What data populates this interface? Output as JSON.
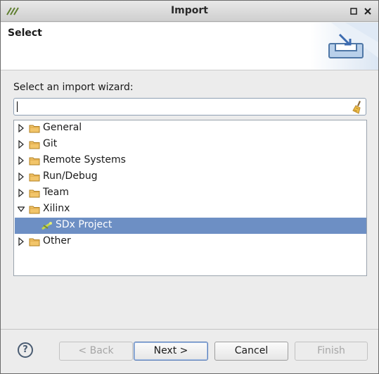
{
  "window": {
    "title": "Import"
  },
  "banner": {
    "heading": "Select"
  },
  "wizard": {
    "prompt": "Select an import wizard:",
    "filter_value": "",
    "tree": [
      {
        "label": "General",
        "expanded": false
      },
      {
        "label": "Git",
        "expanded": false
      },
      {
        "label": "Remote Systems",
        "expanded": false
      },
      {
        "label": "Run/Debug",
        "expanded": false
      },
      {
        "label": "Team",
        "expanded": false
      },
      {
        "label": "Xilinx",
        "expanded": true,
        "children": [
          {
            "label": "SDx Project",
            "selected": true
          }
        ]
      },
      {
        "label": "Other",
        "expanded": false
      }
    ]
  },
  "buttons": {
    "help": "?",
    "back": "< Back",
    "next": "Next >",
    "cancel": "Cancel",
    "finish": "Finish"
  },
  "colors": {
    "selection": "#6d8fc4",
    "folder": "#e8b04a",
    "banner_bg": "#ffffff",
    "dialog_bg": "#ececec"
  }
}
